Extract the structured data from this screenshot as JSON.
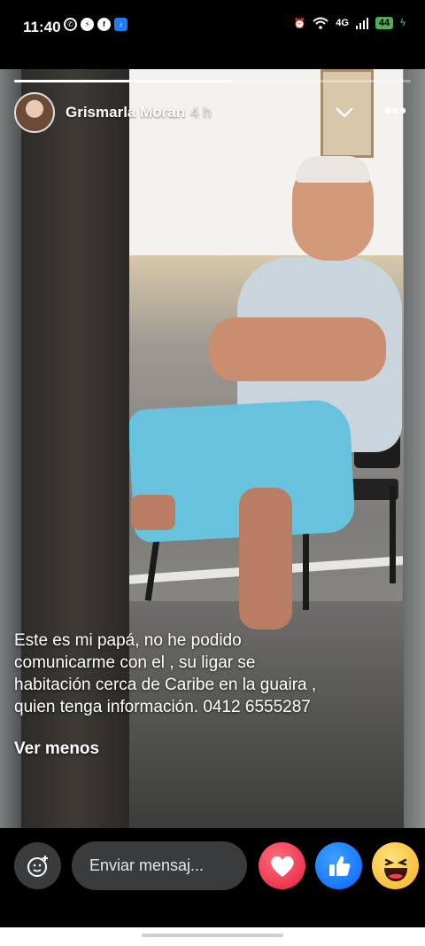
{
  "status_bar": {
    "time": "11:40",
    "network": "4G",
    "battery": "44"
  },
  "story": {
    "progress_fraction": 0.55,
    "author": "Grismarla Moran",
    "time_ago": "4 h",
    "more_label": "•••",
    "caption": "Este es mi papá, no he podido\ncomunicarme con el , su ligar se\nhabitación cerca de Caribe en la guaira ,\nquien tenga información.  0412 6555287",
    "see_less_label": "Ver menos"
  },
  "composer": {
    "placeholder": "Enviar mensaj..."
  },
  "reactions": [
    "love-icon",
    "like-icon",
    "haha-icon"
  ],
  "colors": {
    "love": "#e41e3f",
    "like": "#0866ff",
    "haha": "#f7b125",
    "input_bg": "#3a3b3c"
  }
}
